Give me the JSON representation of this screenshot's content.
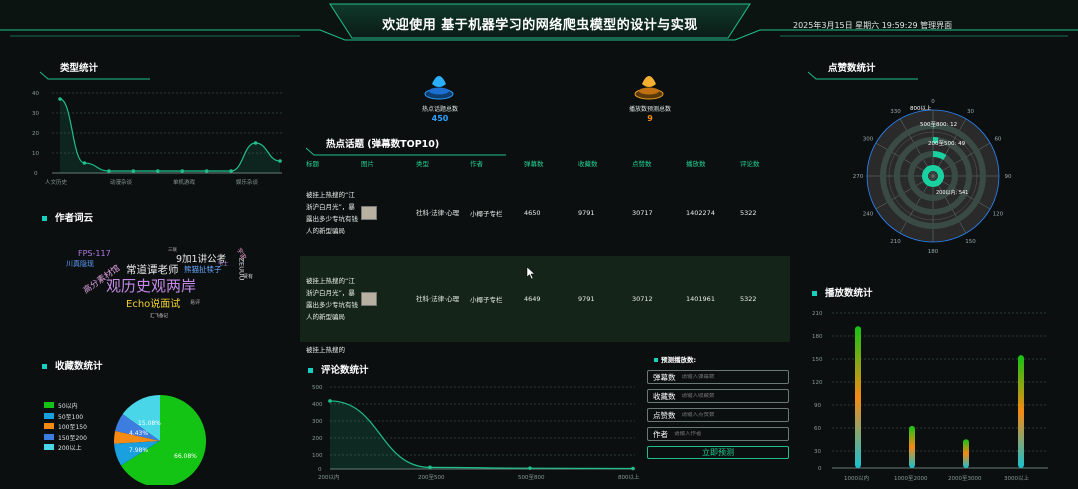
{
  "header": {
    "title": "欢迎使用 基于机器学习的网络爬虫模型的设计与实现",
    "datetime": "2025年3月15日 星期六 19:59:29 管理界面"
  },
  "type_stats": {
    "title": "类型统计",
    "y_ticks": [
      "40",
      "30",
      "20",
      "10",
      "0"
    ],
    "x_labels": [
      "人文历史",
      "动漫杂谈",
      "单机游戏",
      "娱乐杂谈"
    ]
  },
  "stats": {
    "hot_label": "热点话题总数",
    "hot_value": "450",
    "pred_label": "播放数预测总数",
    "pred_value": "9"
  },
  "hot_topics": {
    "title": "热点话题 (弹幕数TOP10)",
    "columns": [
      "标题",
      "图片",
      "类型",
      "作者",
      "弹幕数",
      "收藏数",
      "点赞数",
      "播放数",
      "评论数"
    ],
    "rows": [
      {
        "title": "被挂上热搜的“江浙沪白月光”，暴露出多少专坑有钱人的新型骗局",
        "type": "社科·法律·心理",
        "author": "小椰子专栏",
        "danmaku": "4650",
        "fav": "9791",
        "like": "30717",
        "play": "1402274",
        "comment": "5322"
      },
      {
        "title": "被挂上热搜的“江浙沪白月光”，暴露出多少专坑有钱人的新型骗局",
        "type": "社科·法律·心理",
        "author": "小椰子专栏",
        "danmaku": "4649",
        "fav": "9791",
        "like": "30712",
        "play": "1401961",
        "comment": "5322"
      }
    ],
    "partial_row": "被挂上热搜的"
  },
  "author_cloud": {
    "title": "作者词云",
    "words": [
      "FPS-117",
      "9加1讲公考",
      "川真隐现",
      "高分素材馆",
      "常道谭老师",
      "熊猫扯犊子",
      "观历史观两岸",
      "Echo说面试",
      "ZEUUU",
      "三联",
      "毛士",
      "贤有",
      "宇宙",
      "汇飞备记",
      "易评"
    ]
  },
  "fav_stats": {
    "title": "收藏数统计",
    "legend": [
      "50以内",
      "50至100",
      "100至150",
      "150至200",
      "200以上"
    ],
    "percents": [
      "66.08%",
      "7.98%",
      "4.43%",
      "15.08%"
    ],
    "colors": [
      "#14c414",
      "#1a9fe0",
      "#f58a14",
      "#3d7de0",
      "#48d6e8"
    ]
  },
  "comment_stats": {
    "title": "评论数统计",
    "y_ticks": [
      "500",
      "400",
      "300",
      "200",
      "100",
      "0"
    ],
    "x_labels": [
      "200以内",
      "200至500",
      "500至800",
      "800以上"
    ]
  },
  "predict": {
    "title": "预测播放数:",
    "fields": [
      {
        "label": "弹幕数",
        "placeholder": "请输入弹幕数"
      },
      {
        "label": "收藏数",
        "placeholder": "请输入收藏数"
      },
      {
        "label": "点赞数",
        "placeholder": "请输入点赞数"
      },
      {
        "label": "作者",
        "placeholder": "请输入作者"
      }
    ],
    "button": "立即预测"
  },
  "like_stats": {
    "title": "点赞数统计",
    "angle_labels": [
      "0",
      "30",
      "60",
      "90",
      "120",
      "150",
      "180",
      "210",
      "240",
      "270",
      "300",
      "330"
    ],
    "bar_labels": [
      "800以上",
      "500至800: 12",
      "200至500: 49",
      "200以内: 541"
    ]
  },
  "play_stats": {
    "title": "播放数统计",
    "y_ticks": [
      "210",
      "180",
      "150",
      "120",
      "90",
      "60",
      "30",
      "0"
    ],
    "x_labels": [
      "1000以内",
      "1000至2000",
      "2000至3000",
      "3000以上"
    ]
  },
  "chart_data": [
    {
      "type": "line",
      "name": "type_stats",
      "categories": [
        "人文历史",
        "动漫杂谈",
        "单机游戏",
        "娱乐杂谈"
      ],
      "x_count": 10,
      "values": [
        37,
        5,
        1,
        1,
        1,
        1,
        1,
        1,
        15,
        6
      ],
      "ylim": [
        0,
        40
      ]
    },
    {
      "type": "pie",
      "name": "fav_stats",
      "labels": [
        "50以内",
        "50至100",
        "100至150",
        "150至200",
        "200以上"
      ],
      "values": [
        66.08,
        7.98,
        4.43,
        6.43,
        15.08
      ]
    },
    {
      "type": "line",
      "name": "comment_stats",
      "categories": [
        "200以内",
        "200至500",
        "500至800",
        "800以上"
      ],
      "values": [
        415,
        10,
        5,
        3
      ],
      "ylim": [
        0,
        500
      ]
    },
    {
      "type": "bar",
      "name": "play_stats",
      "categories": [
        "1000以内",
        "1000至2000",
        "2000至3000",
        "3000以上"
      ],
      "values": [
        192,
        57,
        39,
        153
      ],
      "ylim": [
        0,
        210
      ]
    },
    {
      "type": "bar",
      "name": "like_stats",
      "polar": true,
      "categories": [
        "200以内",
        "200至500",
        "500至800",
        "800以上"
      ],
      "values": [
        541,
        49,
        12,
        1
      ]
    }
  ]
}
